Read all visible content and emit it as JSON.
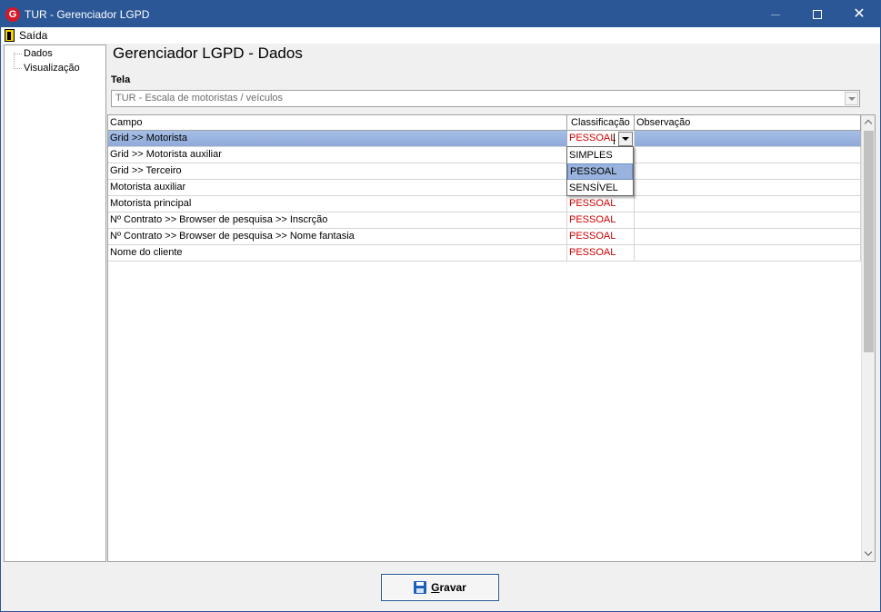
{
  "window": {
    "title": "TUR - Gerenciador LGPD",
    "app_icon_letter": "G",
    "minimize_symbol": "—",
    "maximize_symbol": "☐",
    "close_symbol": "✕"
  },
  "menu": {
    "exit_label": "Saída",
    "exit_icon": "door-exit-icon"
  },
  "tree": {
    "items": [
      {
        "label": "Dados"
      },
      {
        "label": "Visualização"
      }
    ]
  },
  "main": {
    "title": "Gerenciador LGPD - Dados",
    "tela_label": "Tela",
    "tela_value": "TUR - Escala de motoristas / veículos"
  },
  "grid": {
    "columns": [
      "Campo",
      "Classificação",
      "Observação"
    ],
    "rows": [
      {
        "campo": "Grid >> Motorista",
        "classificacao": "PESSOAL",
        "observacao": "",
        "selected": true
      },
      {
        "campo": "Grid >> Motorista auxiliar",
        "classificacao": "",
        "observacao": ""
      },
      {
        "campo": "Grid >> Terceiro",
        "classificacao": "",
        "observacao": ""
      },
      {
        "campo": "Motorista auxiliar",
        "classificacao": "",
        "observacao": ""
      },
      {
        "campo": "Motorista principal",
        "classificacao": "PESSOAL",
        "observacao": ""
      },
      {
        "campo": "Nº Contrato >> Browser de pesquisa >> Inscrção",
        "classificacao": "PESSOAL",
        "observacao": ""
      },
      {
        "campo": "Nº Contrato >> Browser de pesquisa >> Nome fantasia",
        "classificacao": "PESSOAL",
        "observacao": ""
      },
      {
        "campo": "Nome do cliente",
        "classificacao": "PESSOAL",
        "observacao": ""
      }
    ],
    "dropdown_options": [
      "SIMPLES",
      "PESSOAL",
      "SENSÍVEL"
    ],
    "dropdown_highlighted": "PESSOAL"
  },
  "footer": {
    "save_label_first": "G",
    "save_label_rest": "ravar",
    "save_icon": "floppy-disk-icon"
  },
  "colors": {
    "titlebar": "#2b5797",
    "classification_text": "#cc0000",
    "selected_row": "#9ab3de"
  }
}
